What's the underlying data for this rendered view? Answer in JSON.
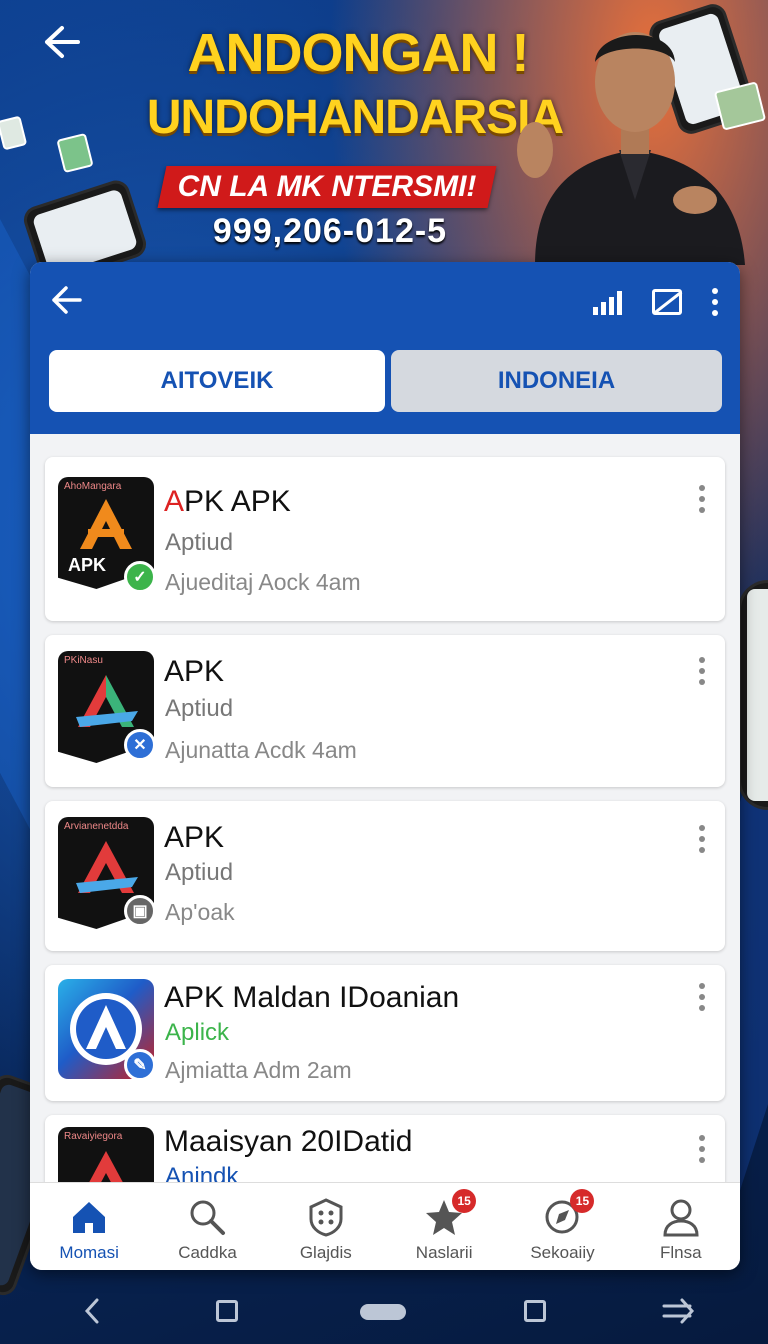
{
  "banner": {
    "back_icon": "arrow-left-icon",
    "headline_1": "ANDONGAN !",
    "headline_2": "UNDOHANDARSIA",
    "promo": "CN LA MK NTERSMI!",
    "phone_number": "999,206-012-5"
  },
  "header": {
    "back_icon": "arrow-left-icon",
    "icons": [
      "signal-icon",
      "no-sim-icon",
      "more-vert-icon"
    ]
  },
  "tabs": [
    {
      "label": "AITOVEIK",
      "active": true
    },
    {
      "label": "INDONEIA",
      "active": false
    }
  ],
  "apps": [
    {
      "icon_text": "AhoMangara",
      "icon_label": "APK",
      "title_first": "A",
      "title_rest": "PK APK",
      "subtitle": "Aptiud",
      "meta": "Ajueditaj Aock 4am",
      "badge_color": "#3cb44b",
      "badge_icon": "check-icon"
    },
    {
      "icon_text": "PKiNasu",
      "title": "APK",
      "subtitle": "Aptiud",
      "meta": "Ajunatta Acdk 4am",
      "badge_color": "#2e6fd6",
      "badge_icon": "close-icon"
    },
    {
      "icon_text": "Arvianenetdda",
      "title": "APK",
      "subtitle": "Aptiud",
      "meta": "Ap'oak",
      "badge_color": "#666666",
      "badge_icon": "image-icon"
    },
    {
      "title": "APK Maldan IDoanian",
      "subtitle": "Aplick",
      "meta": "Ajmiatta Adm 2am",
      "badge_color": "#2e6fd6",
      "badge_icon": "edit-icon"
    },
    {
      "icon_text": "Ravaiyiegora",
      "title": "Maaisyan 20IDatid",
      "subtitle": "Anindk"
    }
  ],
  "bottom_nav": [
    {
      "label": "Momasi",
      "icon": "home-icon",
      "active": true
    },
    {
      "label": "Caddka",
      "icon": "search-icon",
      "active": false
    },
    {
      "label": "Glajdis",
      "icon": "apps-shield-icon",
      "active": false
    },
    {
      "label": "Naslarii",
      "icon": "star-icon",
      "active": false,
      "badge": "15"
    },
    {
      "label": "Sekoaiiy",
      "icon": "compass-icon",
      "active": false,
      "badge": "15"
    },
    {
      "label": "Flnsa",
      "icon": "person-icon",
      "active": false
    }
  ],
  "colors": {
    "header": "#1552b3",
    "headline": "#ffd21f",
    "promo": "#d01a1a"
  }
}
